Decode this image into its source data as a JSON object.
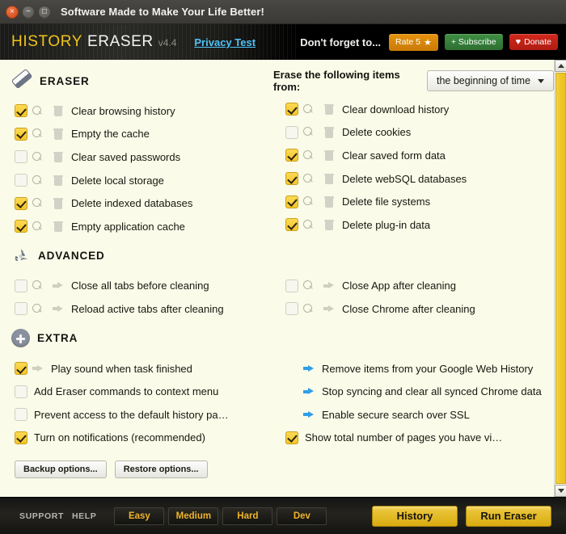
{
  "window": {
    "title": "Software Made to Make Your Life Better!",
    "close_icon": "close-icon",
    "minimize_icon": "minimize-icon",
    "maximize_icon": "maximize-icon"
  },
  "brand": {
    "name_primary": "HISTORY",
    "name_secondary": "ERASER",
    "version": "v4.4",
    "privacy_link": "Privacy Test",
    "dont_forget": "Don't forget to...",
    "rate_label": "Rate 5",
    "rate_glyph": "★",
    "subscribe_label": "+ Subscribe",
    "donate_label": "Donate",
    "donate_glyph": "♥",
    "colors": {
      "gold": "#f0c419",
      "cyan": "#4fc3f7",
      "rate_orange": "#e8930e",
      "subscribe_green": "#3f8f43",
      "donate_red": "#d3291d"
    }
  },
  "erase_from": {
    "label": "Erase the following items from:",
    "selected": "the beginning of time",
    "caret_icon": "chevron-down-icon"
  },
  "sections": {
    "eraser": {
      "title": "ERASER",
      "icon": "eraser-icon",
      "left_items": [
        {
          "label": "Clear browsing history",
          "checked": true
        },
        {
          "label": "Empty the cache",
          "checked": true
        },
        {
          "label": "Clear saved passwords",
          "checked": false
        },
        {
          "label": "Delete local storage",
          "checked": false
        },
        {
          "label": "Delete indexed databases",
          "checked": true
        },
        {
          "label": "Empty application cache",
          "checked": true
        }
      ],
      "right_items": [
        {
          "label": "Clear download history",
          "checked": true
        },
        {
          "label": "Delete cookies",
          "checked": false
        },
        {
          "label": "Clear saved form data",
          "checked": true
        },
        {
          "label": "Delete webSQL databases",
          "checked": true
        },
        {
          "label": "Delete file systems",
          "checked": true
        },
        {
          "label": "Delete plug-in data",
          "checked": true
        }
      ]
    },
    "advanced": {
      "title": "ADVANCED",
      "icon": "recycle-icon",
      "left_items": [
        {
          "label": "Close all tabs before cleaning",
          "checked": false
        },
        {
          "label": "Reload active tabs after cleaning",
          "checked": false
        }
      ],
      "right_items": [
        {
          "label": "Close App after cleaning",
          "checked": false
        },
        {
          "label": "Close Chrome after cleaning",
          "checked": false
        }
      ]
    },
    "extra": {
      "title": "EXTRA",
      "icon": "plus-circle-icon",
      "left_items": [
        {
          "label": "Play sound when task finished",
          "checked": true,
          "arrow": "grey"
        },
        {
          "label": "Add Eraser commands to context menu",
          "checked": false,
          "arrow": "none"
        },
        {
          "label": "Prevent access to the default history pa…",
          "checked": false,
          "arrow": "none"
        },
        {
          "label": "Turn on notifications (recommended)",
          "checked": true,
          "arrow": "none"
        }
      ],
      "right_items": [
        {
          "label": "Remove items from your Google Web History",
          "checkbox": false,
          "arrow": "blue"
        },
        {
          "label": "Stop syncing and clear all synced Chrome data",
          "checkbox": false,
          "arrow": "blue"
        },
        {
          "label": "Enable secure search over SSL",
          "checkbox": false,
          "arrow": "blue"
        },
        {
          "label": "Show total number of pages you have vi…",
          "checkbox": true,
          "checked": true,
          "arrow": "none"
        }
      ]
    }
  },
  "options_buttons": {
    "backup": "Backup options...",
    "restore": "Restore options..."
  },
  "scrollbar": {
    "up_icon": "scroll-up-arrow-icon",
    "down_icon": "scroll-down-arrow-icon",
    "thumb_color": "#f0c828"
  },
  "footer": {
    "support": "SUPPORT",
    "help": "HELP",
    "difficulty": [
      "Easy",
      "Medium",
      "Hard",
      "Dev"
    ],
    "history_button": "History",
    "run_button": "Run Eraser",
    "gold": "#e9c336"
  }
}
